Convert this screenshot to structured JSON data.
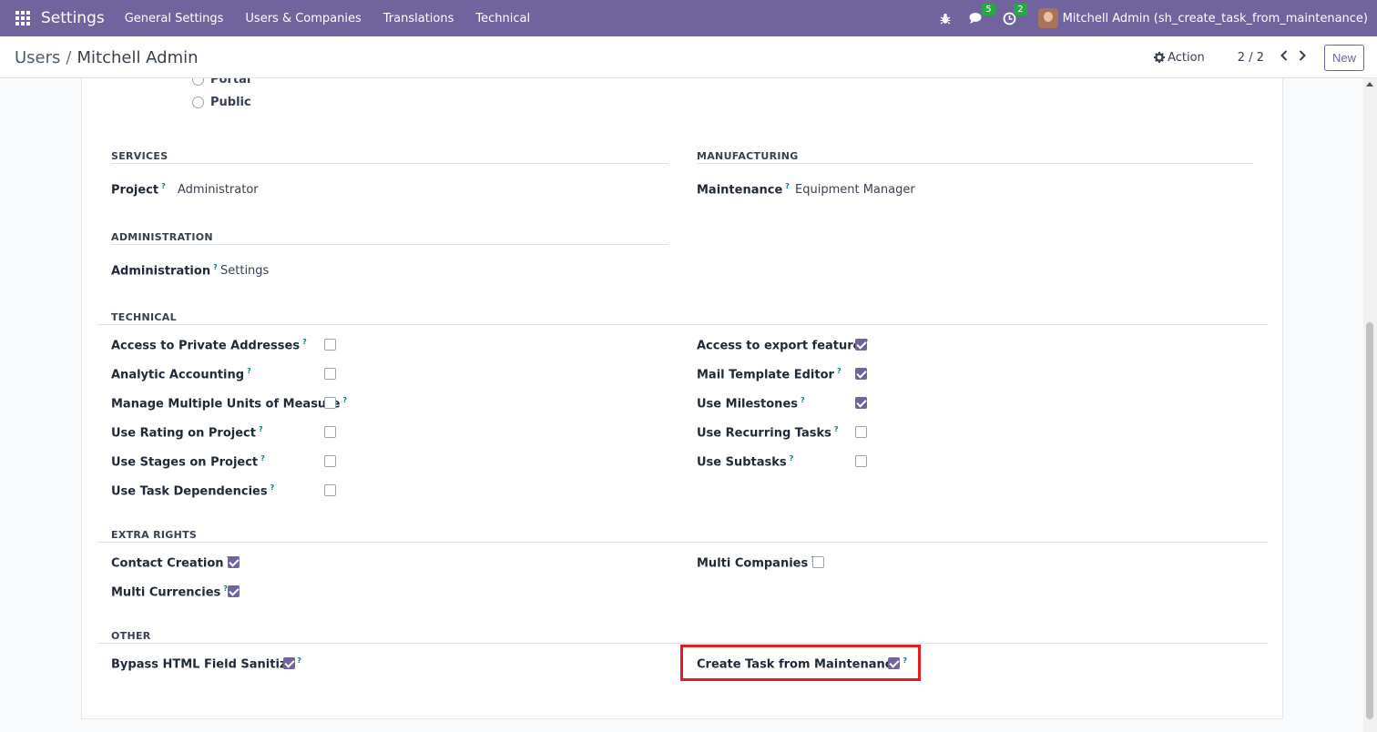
{
  "topbar": {
    "app_name": "Settings",
    "menu": [
      "General Settings",
      "Users & Companies",
      "Translations",
      "Technical"
    ],
    "messages_count": "5",
    "activities_count": "2",
    "user_label": "Mitchell Admin (sh_create_task_from_maintenance)"
  },
  "controlbar": {
    "breadcrumb_parent": "Users",
    "breadcrumb_sep": "/",
    "breadcrumb_current": "Mitchell Admin",
    "action_label": "Action",
    "pager": "2 / 2",
    "new_label": "New"
  },
  "user_types": [
    "Portal",
    "Public"
  ],
  "sections": {
    "services": {
      "title": "SERVICES",
      "field_label": "Project",
      "field_value": "Administrator"
    },
    "manufacturing": {
      "title": "MANUFACTURING",
      "field_label": "Maintenance",
      "field_value": "Equipment Manager"
    },
    "administration": {
      "title": "ADMINISTRATION",
      "field_label": "Administration",
      "field_value": "Settings"
    },
    "technical": {
      "title": "TECHNICAL",
      "left": [
        {
          "label": "Access to Private Addresses",
          "checked": false
        },
        {
          "label": "Analytic Accounting",
          "checked": false
        },
        {
          "label": "Manage Multiple Units of Measure",
          "checked": false
        },
        {
          "label": "Use Rating on Project",
          "checked": false
        },
        {
          "label": "Use Stages on Project",
          "checked": false
        },
        {
          "label": "Use Task Dependencies",
          "checked": false
        }
      ],
      "right": [
        {
          "label": "Access to export feature",
          "checked": true
        },
        {
          "label": "Mail Template Editor",
          "checked": true
        },
        {
          "label": "Use Milestones",
          "checked": true
        },
        {
          "label": "Use Recurring Tasks",
          "checked": false
        },
        {
          "label": "Use Subtasks",
          "checked": false
        }
      ]
    },
    "extra_rights": {
      "title": "EXTRA RIGHTS",
      "left": [
        {
          "label": "Contact Creation",
          "checked": true
        },
        {
          "label": "Multi Currencies",
          "checked": true
        }
      ],
      "right": [
        {
          "label": "Multi Companies",
          "checked": false
        }
      ]
    },
    "other": {
      "title": "OTHER",
      "left": [
        {
          "label": "Bypass HTML Field Sanitize",
          "checked": true
        }
      ],
      "right": [
        {
          "label": "Create Task from Maintenance",
          "checked": true
        }
      ]
    }
  },
  "help_mark": "?",
  "colors": {
    "brand": "#71639e",
    "highlight": "#e41c1c",
    "badge": "#28a745"
  }
}
